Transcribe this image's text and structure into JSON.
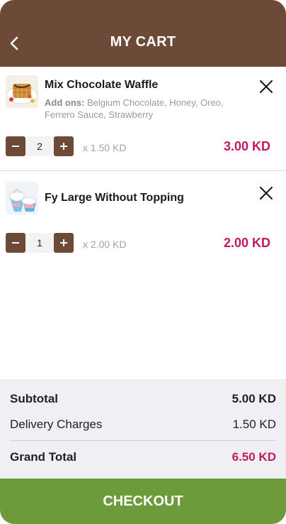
{
  "header": {
    "title": "MY CART",
    "back_icon": "chevron-left-icon"
  },
  "items": [
    {
      "name": "Mix Chocolate Waffle",
      "addons_label": "Add ons:",
      "addons": "Belgium Chocolate, Honey, Oreo, Ferrero Sauce, Strawberry",
      "quantity": "2",
      "unit_price": "x 1.50 KD",
      "line_total": "3.00 KD"
    },
    {
      "name": "Fy Large Without Topping",
      "quantity": "1",
      "unit_price": "x 2.00 KD",
      "line_total": "2.00 KD"
    }
  ],
  "summary": {
    "subtotal_label": "Subtotal",
    "subtotal_value": "5.00 KD",
    "delivery_label": "Delivery Charges",
    "delivery_value": "1.50 KD",
    "grand_label": "Grand Total",
    "grand_value": "6.50 KD"
  },
  "checkout_label": "CHECKOUT",
  "colors": {
    "header": "#6d4937",
    "accent_price": "#c4185e",
    "checkout": "#6d9b3c",
    "summary_bg": "#f0f0f4"
  }
}
